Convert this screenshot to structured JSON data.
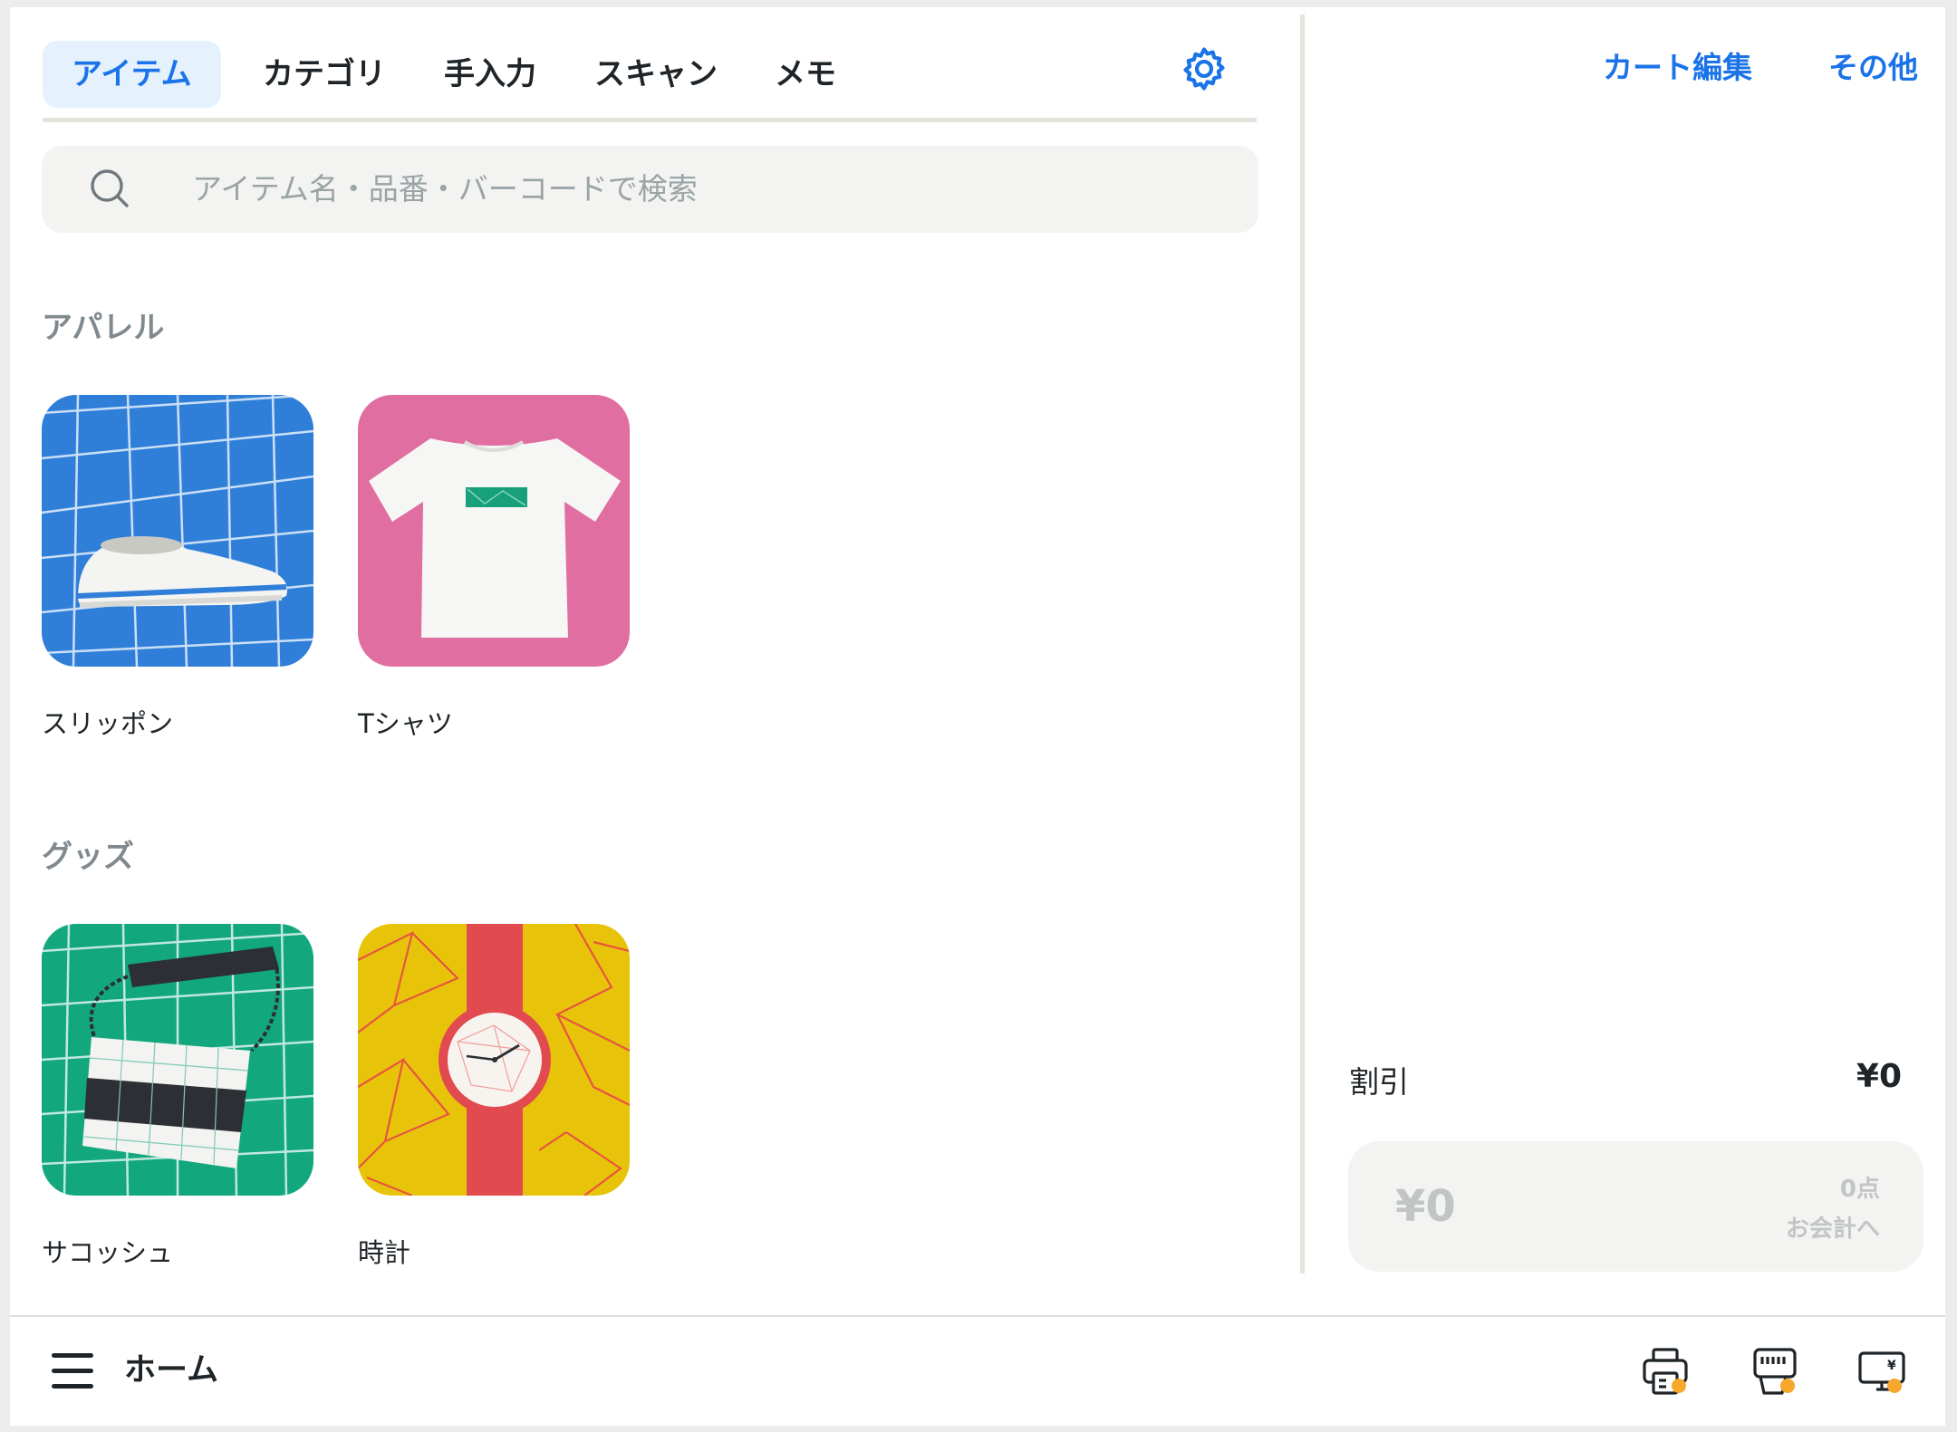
{
  "tabs": [
    {
      "label": "アイテム",
      "active": true
    },
    {
      "label": "カテゴリ",
      "active": false
    },
    {
      "label": "手入力",
      "active": false
    },
    {
      "label": "スキャン",
      "active": false
    },
    {
      "label": "メモ",
      "active": false
    }
  ],
  "search": {
    "placeholder": "アイテム名・品番・バーコードで検索"
  },
  "sections": [
    {
      "title": "アパレル",
      "items": [
        {
          "name": "スリッポン",
          "thumb_color": "#2f7fd9",
          "thumb_icon": "sneaker-image"
        },
        {
          "name": "Tシャツ",
          "thumb_color": "#e06ea1",
          "thumb_icon": "tshirt-image"
        }
      ]
    },
    {
      "title": "グッズ",
      "items": [
        {
          "name": "サコッシュ",
          "thumb_color": "#13a77e",
          "thumb_icon": "bag-image"
        },
        {
          "name": "時計",
          "thumb_color": "#e7c40a",
          "thumb_icon": "watch-image"
        }
      ]
    }
  ],
  "cart": {
    "edit_label": "カート編集",
    "more_label": "その他",
    "discount_label": "割引",
    "discount_value": "¥0",
    "total": "¥0",
    "count": "0点",
    "checkout_label": "お会計へ"
  },
  "bottom": {
    "home_label": "ホーム",
    "device_icons": [
      "printer-icon",
      "card-reader-icon",
      "customer-display-icon"
    ],
    "status_dot_color": "#f7a72b"
  },
  "colors": {
    "accent": "#1a73e8",
    "tab_active_bg": "#e5f1fd"
  }
}
